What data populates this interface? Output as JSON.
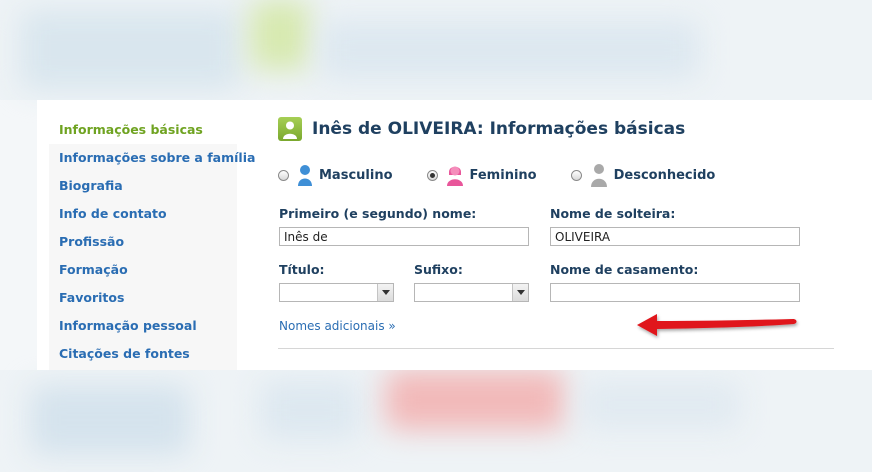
{
  "sidebar": {
    "items": [
      {
        "label": "Informações básicas"
      },
      {
        "label": "Informações sobre a família"
      },
      {
        "label": "Biografia"
      },
      {
        "label": "Info de contato"
      },
      {
        "label": "Profissão"
      },
      {
        "label": "Formação"
      },
      {
        "label": "Favoritos"
      },
      {
        "label": "Informação pessoal"
      },
      {
        "label": "Citações de fontes"
      }
    ],
    "active_index": 0
  },
  "header": {
    "title": "Inês de OLIVEIRA: Informações básicas"
  },
  "gender": {
    "options": [
      {
        "label": "Masculino",
        "icon": "male-person-icon",
        "selected": false
      },
      {
        "label": "Feminino",
        "icon": "female-person-icon",
        "selected": true
      },
      {
        "label": "Desconhecido",
        "icon": "unknown-person-icon",
        "selected": false
      }
    ]
  },
  "form": {
    "first_name_label": "Primeiro (e segundo) nome:",
    "first_name_value": "Inês de",
    "maiden_name_label": "Nome de solteira:",
    "maiden_name_value": "OLIVEIRA",
    "title_label": "Título:",
    "suffix_label": "Sufixo:",
    "married_name_label": "Nome de casamento:",
    "married_name_value": "",
    "more_names_link": "Nomes adicionais »"
  },
  "colors": {
    "accent_green": "#6fa321",
    "link_blue": "#2a6db3",
    "heading_navy": "#1f4060",
    "annotation_red": "#e0141b"
  }
}
